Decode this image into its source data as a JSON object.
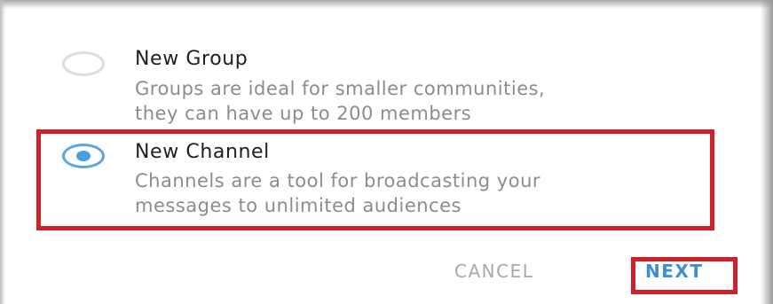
{
  "dialog": {
    "options": [
      {
        "title": "New Group",
        "description_line1": "Groups are ideal for smaller communities,",
        "description_line2": "they can have up to 200 members",
        "selected": false
      },
      {
        "title": "New Channel",
        "description_line1": "Channels are a tool for broadcasting your",
        "description_line2": "messages to unlimited audiences",
        "selected": true
      }
    ],
    "actions": {
      "cancel_label": "CANCEL",
      "next_label": "NEXT"
    }
  },
  "colors": {
    "accent": "#4a9fe0",
    "highlight_box": "#d0202a",
    "title_text": "#1f1f1f",
    "description_text": "#8c8c8c",
    "cancel_text": "#a9a9a9"
  }
}
